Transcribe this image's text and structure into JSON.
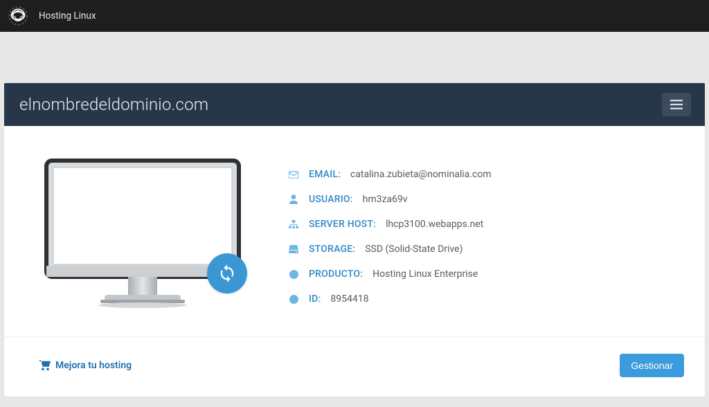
{
  "topbar": {
    "title": "Hosting Linux"
  },
  "header": {
    "domain": "elnombredeldominio.com"
  },
  "info": {
    "email": {
      "label": "EMAIL:",
      "value": "catalina.zubieta@nominalia.com"
    },
    "user": {
      "label": "USUARIO:",
      "value": "hm3za69v"
    },
    "server": {
      "label": "SERVER HOST:",
      "value": "lhcp3100.webapps.net"
    },
    "storage": {
      "label": "STORAGE:",
      "value": "SSD (Solid-State Drive)"
    },
    "product": {
      "label": "PRODUCTO:",
      "value": "Hosting Linux Enterprise"
    },
    "id": {
      "label": "ID:",
      "value": "8954418"
    }
  },
  "footer": {
    "upgrade_label": "Mejora tu hosting",
    "manage_label": "Gestionar"
  }
}
